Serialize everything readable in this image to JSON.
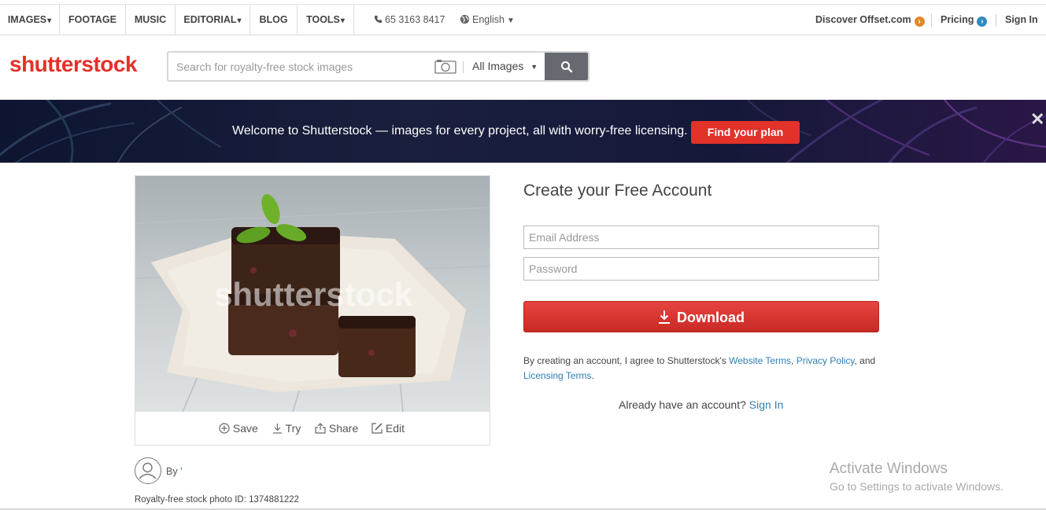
{
  "nav": {
    "tabs": [
      {
        "label": "IMAGES",
        "caret": "▾"
      },
      {
        "label": "FOOTAGE"
      },
      {
        "label": "MUSIC"
      },
      {
        "label": "EDITORIAL",
        "caret": "▾"
      },
      {
        "label": "BLOG"
      },
      {
        "label": "TOOLS",
        "caret": "▾"
      }
    ],
    "phone": "65 3163 8417",
    "language": "English",
    "discover": "Discover Offset.com",
    "pricing": "Pricing",
    "signin": "Sign In",
    "discover_color": "#e08a2b",
    "pricing_color": "#2f8bbf"
  },
  "header": {
    "logo": "shutterstock",
    "search_placeholder": "Search for royalty-free stock images",
    "search_scope": "All Images"
  },
  "banner": {
    "text": "Welcome to Shutterstock — images for every project, all with worry-free licensing.",
    "button": "Find your plan"
  },
  "image": {
    "watermark": "shutterstock",
    "actions": {
      "save": "Save",
      "try": "Try",
      "share": "Share",
      "edit": "Edit"
    },
    "by": "By",
    "photo_id": "Royalty-free stock photo ID: 1374881222"
  },
  "form": {
    "title": "Create your Free Account",
    "email_placeholder": "Email Address",
    "password_placeholder": "Password",
    "download": "Download",
    "terms_prefix": "By creating an account, I agree to Shutterstock's",
    "terms_website": "Website Terms",
    "terms_comma": ",",
    "terms_privacy": "Privacy Policy",
    "terms_and": ", and",
    "terms_licensing": "Licensing Terms",
    "terms_end": ".",
    "already": "Already have an account?",
    "signin_link": "Sign In"
  },
  "os": {
    "activate_title": "Activate Windows",
    "activate_sub": "Go to Settings to activate Windows."
  },
  "colors": {
    "brand": "#e5302a",
    "link": "#2f7fb4"
  }
}
